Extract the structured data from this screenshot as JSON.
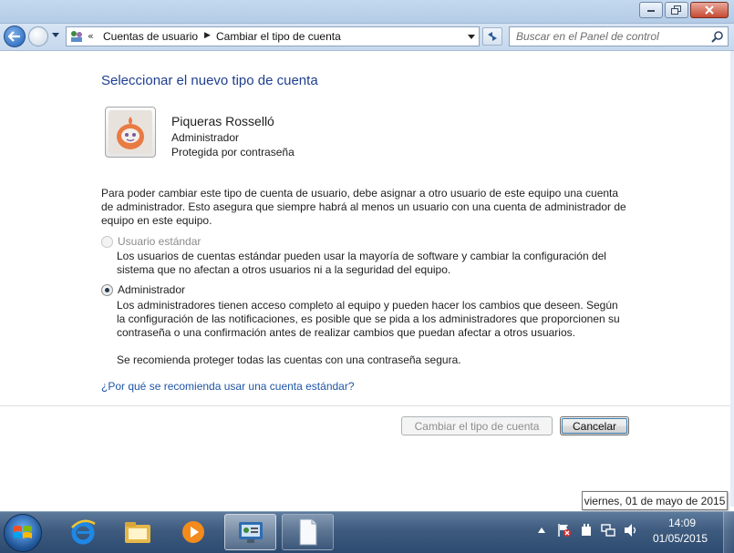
{
  "window": {
    "minimize_icon": "minimize-icon",
    "maximize_icon": "restore-icon",
    "close_icon": "close-icon"
  },
  "navigation": {
    "back_icon": "back-arrow-icon",
    "forward_icon": "forward-arrow-icon",
    "breadcrumb": [
      "Cuentas de usuario",
      "Cambiar el tipo de cuenta"
    ],
    "search_placeholder": "Buscar en el Panel de control"
  },
  "page": {
    "heading": "Seleccionar el nuevo tipo de cuenta",
    "user": {
      "name": "Piqueras Rosselló",
      "role": "Administrador",
      "status": "Protegida por contraseña"
    },
    "intro": "Para poder cambiar este tipo de cuenta de usuario, debe asignar a otro usuario de este equipo una cuenta de administrador. Esto asegura que siempre habrá al menos un usuario con una cuenta de administrador de equipo en este equipo.",
    "options": [
      {
        "label": "Usuario estándar",
        "selected": false,
        "enabled": false,
        "description": "Los usuarios de cuentas estándar pueden usar la mayoría de software y cambiar la configuración del sistema que no afectan a otros usuarios ni a la seguridad del equipo."
      },
      {
        "label": "Administrador",
        "selected": true,
        "enabled": true,
        "description": "Los administradores tienen acceso completo al equipo y pueden hacer los cambios que deseen. Según la configuración de las notificaciones, es posible que se pida a los administradores que proporcionen su contraseña o una confirmación antes de realizar cambios que puedan afectar a otros usuarios."
      }
    ],
    "recommendation": "Se recomienda proteger todas las cuentas con una contraseña segura.",
    "help_link": "¿Por qué se recomienda usar una cuenta estándar?",
    "buttons": {
      "change": "Cambiar el tipo de cuenta",
      "cancel": "Cancelar"
    }
  },
  "tooltip": "viernes, 01 de mayo de 2015",
  "taskbar": {
    "start_icon": "windows-start-icon",
    "apps": [
      "internet-explorer-icon",
      "file-explorer-icon",
      "media-player-icon",
      "control-panel-icon",
      "document-icon"
    ],
    "tray_icons": [
      "show-hidden-icons-arrow",
      "action-center-flag-icon",
      "power-icon",
      "network-icon",
      "volume-icon"
    ],
    "time": "14:09",
    "date": "01/05/2015"
  }
}
